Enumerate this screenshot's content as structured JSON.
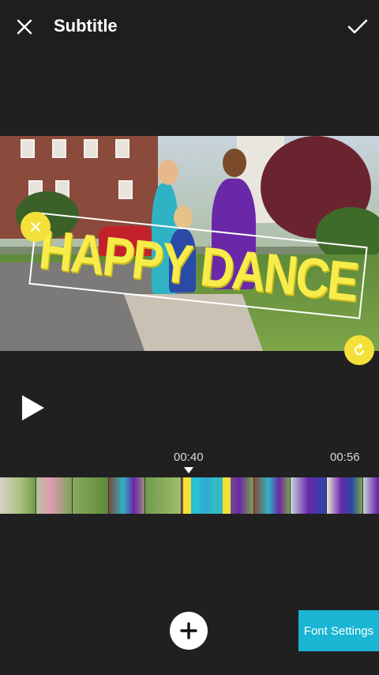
{
  "header": {
    "title": "Subtitle",
    "close_icon": "close-icon",
    "confirm_icon": "check-icon"
  },
  "preview": {
    "subtitle_text": "HAPPY DANCE",
    "subtitle_color": "#f7ec4a",
    "handle_color": "#f4e03a"
  },
  "player": {
    "play_icon": "play-icon"
  },
  "timeline": {
    "marker_current": "00:40",
    "marker_end": "00:56",
    "selection_color": "#26c6da"
  },
  "footer": {
    "add_icon": "plus-icon",
    "font_settings_label": "Font Settings",
    "accent": "#1ab5d2"
  }
}
